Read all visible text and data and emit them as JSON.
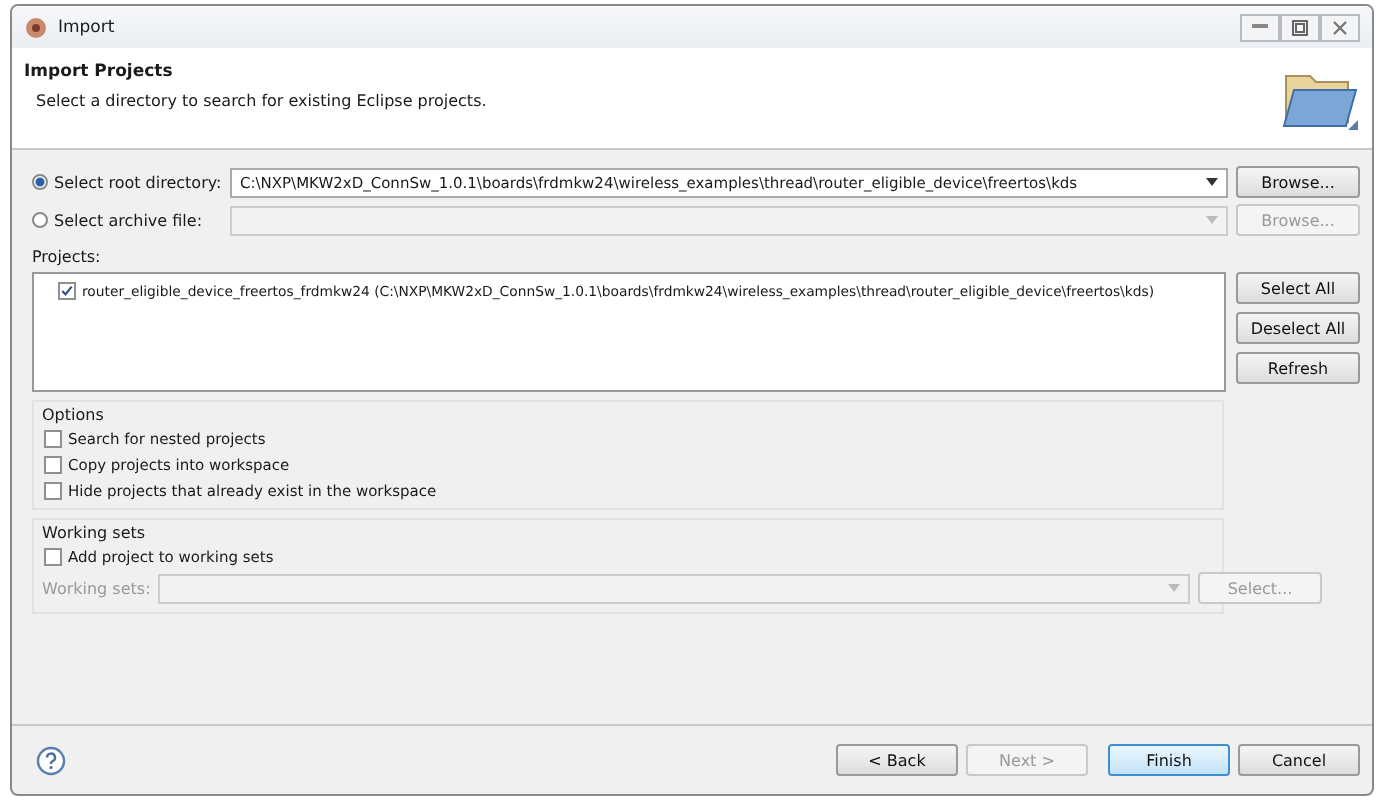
{
  "window": {
    "title": "Import"
  },
  "header": {
    "title": "Import Projects",
    "description": "Select a directory to search for existing Eclipse projects."
  },
  "sources": [
    {
      "label": "Select root directory:",
      "selected": true,
      "value": "C:\\NXP\\MKW2xD_ConnSw_1.0.1\\boards\\frdmkw24\\wireless_examples\\thread\\router_eligible_device\\freertos\\kds",
      "disabled": false,
      "button": "Browse..."
    },
    {
      "label": "Select archive file:",
      "selected": false,
      "disabled": true,
      "button": "Browse..."
    }
  ],
  "projects": {
    "label": "Projects:",
    "items": [
      {
        "label": "router_eligible_device_freertos_frdmkw24 (C:\\NXP\\MKW2xD_ConnSw_1.0.1\\boards\\frdmkw24\\wireless_examples\\thread\\router_eligible_device\\freertos\\kds)",
        "checked": true
      }
    ],
    "buttons": [
      "Select All",
      "Deselect All",
      "Refresh"
    ]
  },
  "options": {
    "title": "Options",
    "checkboxes": [
      {
        "label": "Search for nested projects",
        "checked": false
      },
      {
        "label": "Copy projects into workspace",
        "checked": false
      },
      {
        "label": "Hide projects that already exist in the workspace",
        "checked": false
      }
    ]
  },
  "working_sets": {
    "title": "Working sets",
    "checkbox": {
      "label": "Add project to working sets",
      "checked": false
    },
    "field_label": "Working sets:",
    "disabled": true,
    "button": "Select..."
  },
  "footer_buttons": [
    {
      "label": "< Back",
      "disabled": false,
      "default": false
    },
    {
      "label": "Next >",
      "disabled": true,
      "default": false
    },
    {
      "label": "Finish",
      "disabled": false,
      "default": true
    },
    {
      "label": "Cancel",
      "disabled": false,
      "default": false
    }
  ]
}
